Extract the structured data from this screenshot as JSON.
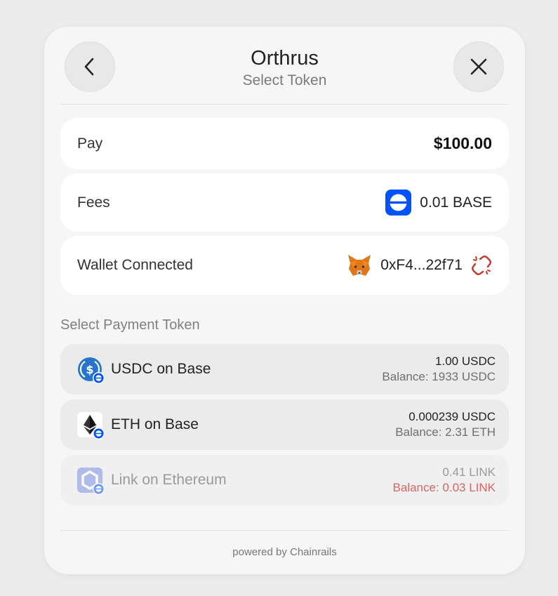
{
  "header": {
    "title": "Orthrus",
    "subtitle": "Select Token",
    "back_icon": "chevron-left-icon",
    "close_icon": "close-icon"
  },
  "summary": {
    "pay": {
      "label": "Pay",
      "value": "$100.00"
    },
    "fees": {
      "label": "Fees",
      "value": "0.01 BASE",
      "icon": "base-logo-icon"
    },
    "wallet": {
      "label": "Wallet Connected",
      "address": "0xF4...22f71",
      "icon": "metamask-fox-icon",
      "disconnect_icon": "disconnect-link-icon"
    }
  },
  "payment_section": {
    "title": "Select Payment Token",
    "tokens": [
      {
        "name": "USDC on Base",
        "amount": "1.00 USDC",
        "balance": "Balance: 1933 USDC",
        "icon": "usdc-icon",
        "disabled": false
      },
      {
        "name": "ETH on Base",
        "amount": "0.000239 USDC",
        "balance": "Balance: 2.31 ETH",
        "icon": "eth-icon",
        "disabled": false
      },
      {
        "name": "Link on Ethereum",
        "amount": "0.41 LINK",
        "balance": "Balance: 0.03 LINK",
        "icon": "chainlink-icon",
        "disabled": true
      }
    ]
  },
  "footer": {
    "text": "powered by Chainrails"
  },
  "colors": {
    "accent_blue": "#0052ff",
    "usdc_blue": "#2775ca",
    "error_red": "#d96565",
    "disconnect_red": "#c0392b"
  }
}
